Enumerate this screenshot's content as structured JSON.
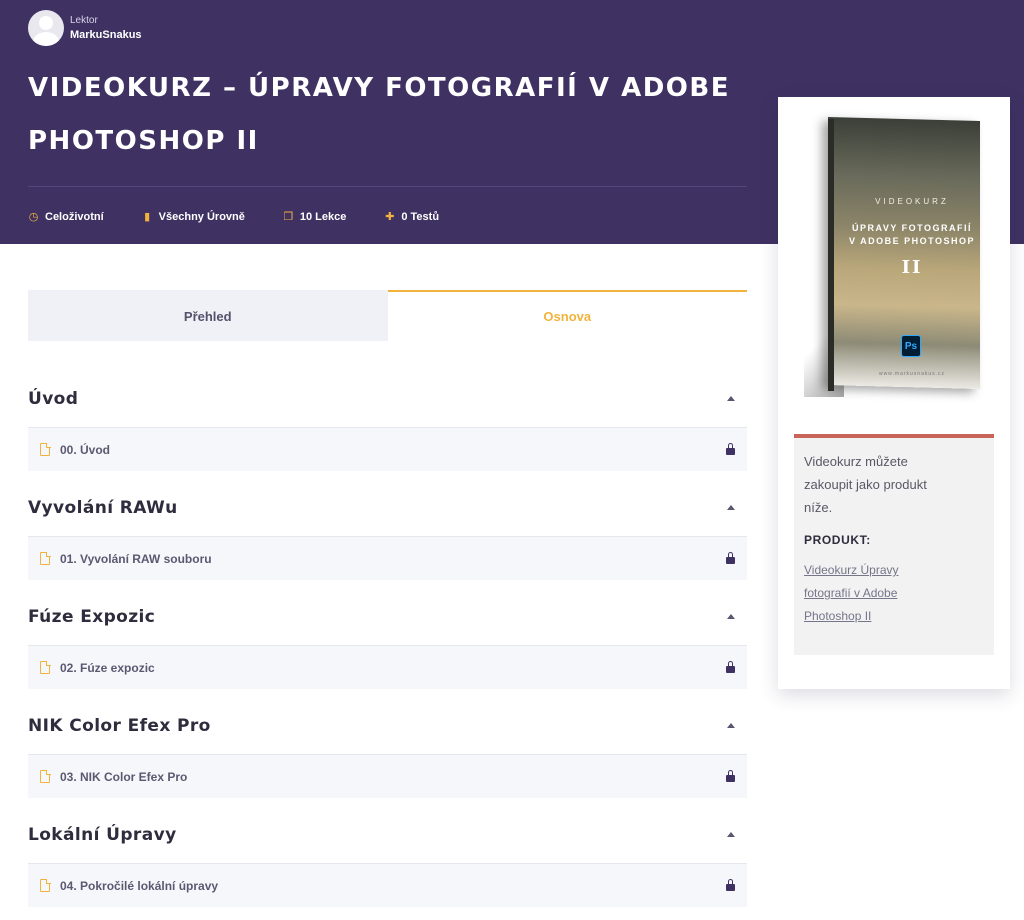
{
  "instructor": {
    "role": "Lektor",
    "name": "MarkuSnakus"
  },
  "course": {
    "title": "VIDEOKURZ – ÚPRAVY FOTOGRAFIÍ V ADOBE PHOTOSHOP II"
  },
  "meta": [
    {
      "icon": "clock-icon",
      "label": "Celoživotní"
    },
    {
      "icon": "bar-chart-icon",
      "label": "Všechny Úrovně"
    },
    {
      "icon": "copy-icon",
      "label": "10 Lekce"
    },
    {
      "icon": "puzzle-icon",
      "label": "0 Testů"
    }
  ],
  "tabs": {
    "overview": "Přehled",
    "curriculum": "Osnova",
    "active": "curriculum"
  },
  "sections": [
    {
      "title": "Úvod",
      "lessons": [
        {
          "label": "00. Úvod",
          "locked": true
        }
      ]
    },
    {
      "title": "Vyvolání RAWu",
      "lessons": [
        {
          "label": "01. Vyvolání RAW souboru",
          "locked": true
        }
      ]
    },
    {
      "title": "Fúze Expozic",
      "lessons": [
        {
          "label": "02. Fúze expozic",
          "locked": true
        }
      ]
    },
    {
      "title": "NIK Color Efex Pro",
      "lessons": [
        {
          "label": "03. NIK Color Efex Pro",
          "locked": true
        }
      ]
    },
    {
      "title": "Lokální Úpravy",
      "lessons": [
        {
          "label": "04. Pokročilé lokální úpravy",
          "locked": true
        }
      ]
    }
  ],
  "sidebar": {
    "cover": {
      "top_text": "VIDEOKURZ",
      "title_line1": "ÚPRAVY FOTOGRAFIÍ",
      "title_line2": "V ADOBE PHOTOSHOP",
      "number": "II",
      "ps_badge": "Ps",
      "url": "www.markusnakus.cz"
    },
    "info_text": "Videokurz můžete zakoupit jako produkt níže.",
    "product_label": "PRODUKT:",
    "product_link": "Videokurz Úpravy fotografií v Adobe Photoshop II"
  },
  "colors": {
    "hero_bg": "#3f3263",
    "accent": "#f2b33d",
    "info_border": "#c8655a"
  }
}
